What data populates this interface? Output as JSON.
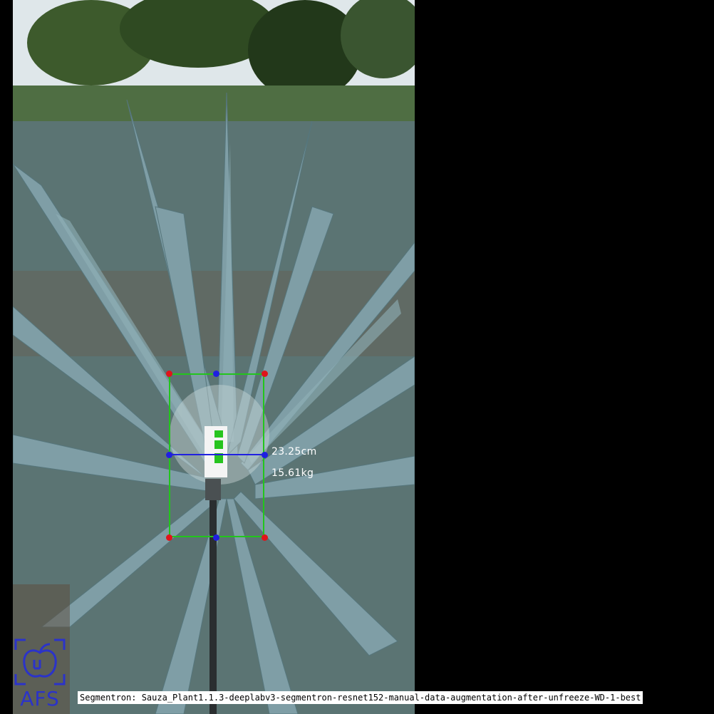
{
  "measurement": {
    "diameter": "23.25cm",
    "weight": "15.61kg",
    "box_color": "#22c51c",
    "corner_color": "#e0141b",
    "midpoint_color": "#1f1fe0"
  },
  "logo": {
    "text": "AFS",
    "icon": "apple-leaf-icon",
    "color": "#2b33c9"
  },
  "caption": {
    "text": "Segmentron: Sauza_Plant1.1.3-deeplabv3-segmentron-resnet152-manual-data-augmentation-after-unfreeze-WD-1-best"
  }
}
